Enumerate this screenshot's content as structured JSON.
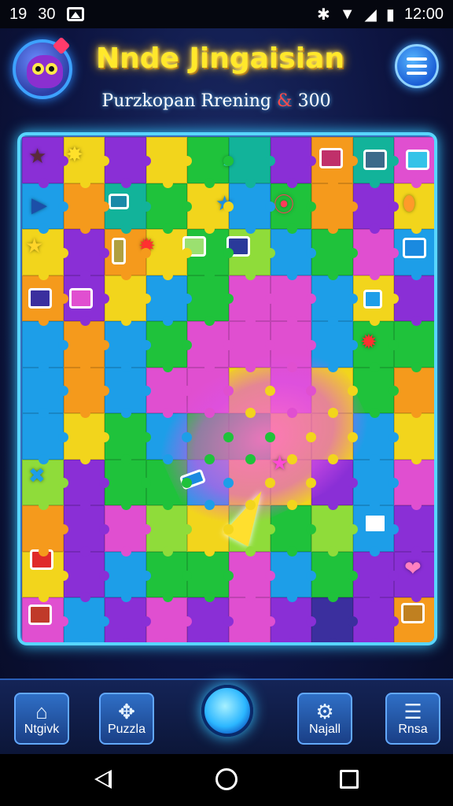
{
  "status_bar": {
    "left_text_1": "19",
    "left_text_2": "30",
    "time": "12:00"
  },
  "header": {
    "title": "Nnde Jingaisian",
    "subtitle_prefix": "Purzkopan Rrening",
    "subtitle_amp": "&",
    "subtitle_score": "300"
  },
  "bottom_nav": {
    "home_label": "Ntgivk",
    "puzzle_label": "Puzzla",
    "settings_label": "Najall",
    "menu_label": "Rnsa"
  },
  "icons": {
    "avatar": "monster-avatar-icon",
    "menu": "hamburger-icon",
    "home": "home-icon",
    "puzzle": "puzzle-icon",
    "settings": "gear-icon",
    "more": "list-icon"
  },
  "colors": {
    "accent": "#58d6ff",
    "title": "#ffe82b"
  }
}
